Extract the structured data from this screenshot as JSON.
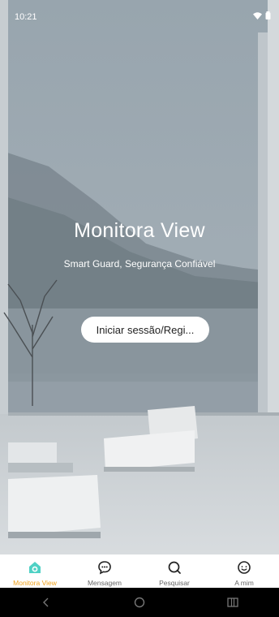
{
  "status_bar": {
    "time": "10:21"
  },
  "hero": {
    "title": "Monitora View",
    "subtitle": "Smart Guard, Segurança Confiável",
    "login_button_label": "Iniciar sessão/Regi..."
  },
  "bottom_nav": {
    "items": [
      {
        "label": "Monitora View",
        "icon": "home-icon",
        "active": true
      },
      {
        "label": "Mensagem",
        "icon": "message-icon",
        "active": false
      },
      {
        "label": "Pesquisar",
        "icon": "search-icon",
        "active": false
      },
      {
        "label": "A mim",
        "icon": "profile-icon",
        "active": false
      }
    ]
  },
  "colors": {
    "accent": "#4fd1c5",
    "active_label": "#f0a21c"
  }
}
